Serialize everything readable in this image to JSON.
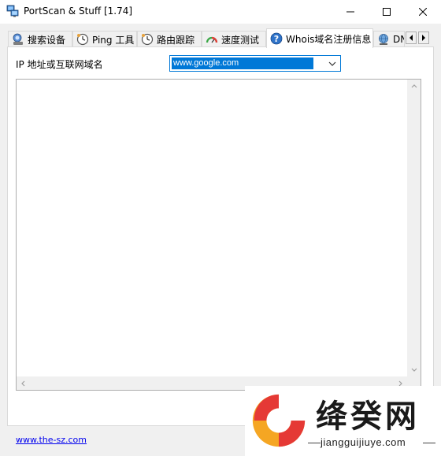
{
  "window": {
    "title": "PortScan & Stuff [1.74]"
  },
  "tabs": [
    {
      "label": "搜索设备",
      "icon": "search-device-icon"
    },
    {
      "label": "Ping 工具",
      "icon": "ping-clock-icon"
    },
    {
      "label": "路由跟踪",
      "icon": "trace-clock-icon"
    },
    {
      "label": "速度测试",
      "icon": "speed-gauge-icon"
    },
    {
      "label": "Whois域名注册信息",
      "icon": "help-question-icon",
      "active": true
    },
    {
      "label": "DN",
      "icon": "dns-globe-icon"
    }
  ],
  "whois": {
    "ip_label": "IP 地址或互联网域名",
    "host_value": "www.google.com",
    "results_text": ""
  },
  "footer": {
    "link": "www.the-sz.com"
  },
  "watermark": {
    "name": "绛癸网",
    "url": "jiangguijiuye.com"
  },
  "colors": {
    "accent": "#0078d7",
    "tab_border": "#d9d9d9",
    "link": "#0000ee",
    "logo_orange": "#f5a623",
    "logo_red": "#e53935"
  }
}
